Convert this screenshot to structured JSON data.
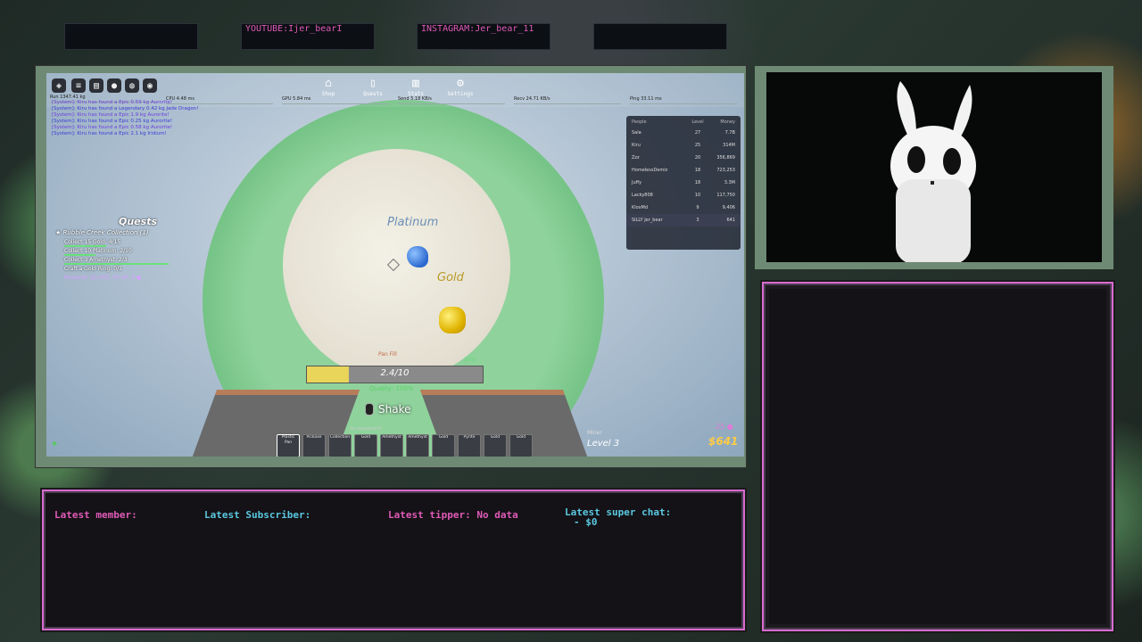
{
  "social": {
    "youtube": "YOUTUBE:Ijer_bearI",
    "instagram": "INSTAGRAM:Jer_bear_11"
  },
  "game": {
    "topnav": {
      "shop": "Shop",
      "quests": "Quests",
      "stats": "Stats",
      "settings": "Settings"
    },
    "stats": [
      {
        "label": "Run",
        "value": "1347.41 kg"
      },
      {
        "label": "CPU",
        "value": "4.48 ms"
      },
      {
        "label": "GPU",
        "value": "5.84 ms"
      },
      {
        "label": "Send",
        "value": "5.18 KB/s"
      },
      {
        "label": "Recv",
        "value": "24.71 KB/s"
      },
      {
        "label": "Ping",
        "value": "33.11 ms"
      }
    ],
    "chat": [
      "[System]: Kiru has found a Epic 0.59 kg Aurorite!",
      "[System]: Kiru has found a Legendary 0.42 kg Jade Dragon!",
      "[System]: Kiru has found a Epic 1.9 kg Aurorite!",
      "[System]: Kiru has found a Epic 0.25 kg Aurorite!",
      "[System]: Kiru has found a Epic 0.58 kg Aurorite!",
      "[System]: Kiru has found a Epic 2.1 kg Iridium!"
    ],
    "quests": {
      "title": "Quests",
      "quest_name": "★ Rubble Creek Collection (1)",
      "items": [
        {
          "text": "Collect 15 Gold: 4/15",
          "progress": 0.27
        },
        {
          "text": "Collect 10 Platinum: 2/10",
          "progress": 0.2
        },
        {
          "text": "Collect 3 Amethyst: 2/3",
          "progress": 0.67
        },
        {
          "text": "Craft a Gold Ring: 0/1",
          "progress": 0
        }
      ],
      "reward": "Rewards: $2,000, 50 XP, 5 ●"
    },
    "leaderboard": {
      "headers": [
        "People",
        "Level",
        "Money"
      ],
      "rows": [
        {
          "name": "Sala",
          "level": "27",
          "money": "7.7B"
        },
        {
          "name": "Kiru",
          "level": "25",
          "money": "314M"
        },
        {
          "name": "Zzz",
          "level": "20",
          "money": "356,869"
        },
        {
          "name": "HomelessDemiz",
          "level": "18",
          "money": "723,253"
        },
        {
          "name": "Juffy",
          "level": "18",
          "money": "3.3M"
        },
        {
          "name": "Lacky808",
          "level": "10",
          "money": "117,750"
        },
        {
          "name": "KloxMd",
          "level": "9",
          "money": "9,406"
        }
      ],
      "self": {
        "name": "SILLY Jer_bear",
        "level": "3",
        "money": "641"
      }
    },
    "labels": {
      "platinum": "Platinum",
      "gold": "Gold"
    },
    "pan": {
      "label": "Pan Fill",
      "value_text": "2.4/10",
      "fill": 0.24,
      "percent": "25%",
      "quality": "Quality: 100%"
    },
    "shake": "Shake",
    "equip_hint": "(a) equipment",
    "hotbar": [
      "Plastic Pan",
      "Pickaxe",
      "Collection",
      "Gold",
      "Amethyst",
      "Amethyst",
      "Gold",
      "Pyrite",
      "Gold",
      "Gold"
    ],
    "level_label": "Miner",
    "level": "Level 3",
    "money": "$641",
    "xp": "25 ●"
  },
  "alerts": {
    "member": "Latest member:",
    "subscriber": "Latest Subscriber:",
    "tipper": "Latest tipper: No data",
    "superchat": "Latest super chat:",
    "superchat_value": "- $0"
  },
  "colors": {
    "accent_pink": "#e05ab8",
    "accent_cyan": "#5ac8e0",
    "frame_green": "#6e8a74"
  }
}
